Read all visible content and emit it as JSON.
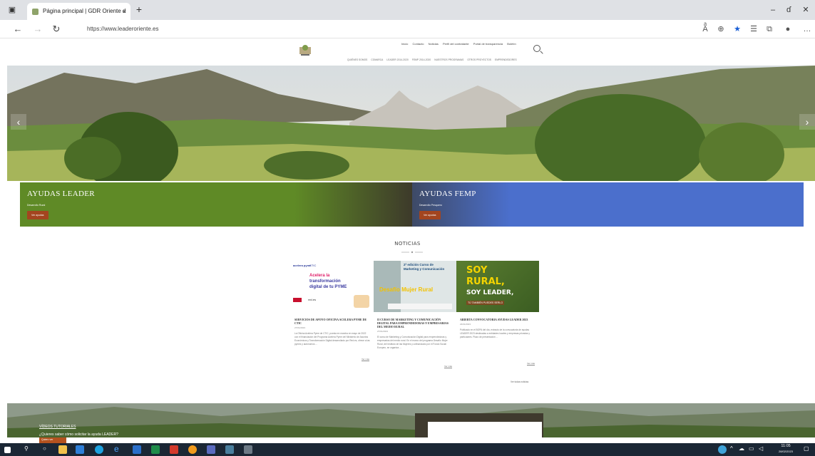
{
  "browser": {
    "tab_title": "Página principal | GDR Oriente d",
    "tab_close": "×",
    "new_tab": "+",
    "url": "https://www.leaderoriente.es",
    "minimize": "–",
    "restore": "ɗ",
    "close": "✕"
  },
  "site": {
    "nav_primary": [
      "Inicio",
      "Contacto",
      "Noticias",
      "Perfil del contratante",
      "Portal de transparencia",
      "Boletín"
    ],
    "nav_secondary": [
      "QUIÉNES SOMOS",
      "COMARCA",
      "LEADER 2014-2020",
      "FEMP 2014-2020",
      "NUESTROS PROGRAMAS",
      "OTROS PROYECTOS",
      "EMPRENDEDORES"
    ]
  },
  "aid_boxes": [
    {
      "title": "AYUDAS LEADER",
      "subtitle": "Desarrollo Rural",
      "button": "Ver ayudas",
      "color": "#5f8a26"
    },
    {
      "title": "AYUDAS FEMP",
      "subtitle": "Desarrollo Pesquero",
      "button": "Ver ayudas",
      "color": "#4b6fcc"
    }
  ],
  "news": {
    "heading": "NOTICIAS",
    "all_news": "Ver todas noticias",
    "items": [
      {
        "title": "SERVICIOS DE APOYO OFICINA ACELERA PYME DE CTIC",
        "date": "27/01/2023",
        "excerpt": "La Oficina Acelera Pyme de CTIC, puesta en marcha en mayo de 2022 con el financiación del Programa Acelera Pyme del Ministerio de Asuntos Económicos y Transformación Digital desarrollado por Red.es, ofrece a las pymes y autónomos ...",
        "more": "Ver más",
        "img_labels": [
          "acelera pyme",
          "CTIC",
          "Acelera la",
          "transformación",
          "digital de tu PYME",
          "red.es"
        ]
      },
      {
        "title": "II CURSO DE MARKETING Y COMUNICACIÓN DIGITAL PARA EMPRENDEDORAS Y EMPRESARIAS DEL MEDIO RURAL",
        "date": "27/01/2023",
        "excerpt": "El curso de Marketing y Comunicación Digital para emprendedoras y empresarias del medio rural. En el marco del programa Desafío Mujer Rural, del Instituto de las Mujeres y cofinanciado por el Fondo Social Europeo, se organiza ...",
        "more": "Ver más",
        "img_labels": [
          "2ª edición Curso de",
          "Marketing y Comunicación",
          "Desafío Mujer Rural"
        ]
      },
      {
        "title": "ABIERTA CONVOCATORIA AYUDAS LEADER 2023",
        "date": "24/01/2023",
        "excerpt": "Publicado en el BOPA del día, extracto de la convocatoria de ayudas LEADER 2023 destinadas a entidades locales y empresas privadas y particulares. Plazo de presentación ...",
        "more": "Ver más",
        "img_labels": [
          "SOY",
          "RURAL,",
          "SOY LEADER,",
          "TÚ TAMBIÉN PUEDES SERLO"
        ]
      }
    ]
  },
  "videos": {
    "title": "VÍDEOS TUTORIALES",
    "subtitle": "¿Quieres saber cómo solicitar la ayuda LEADER?",
    "button": "Quiero ver"
  },
  "taskbar": {
    "time": "11:05",
    "date": "28/02/2023"
  }
}
